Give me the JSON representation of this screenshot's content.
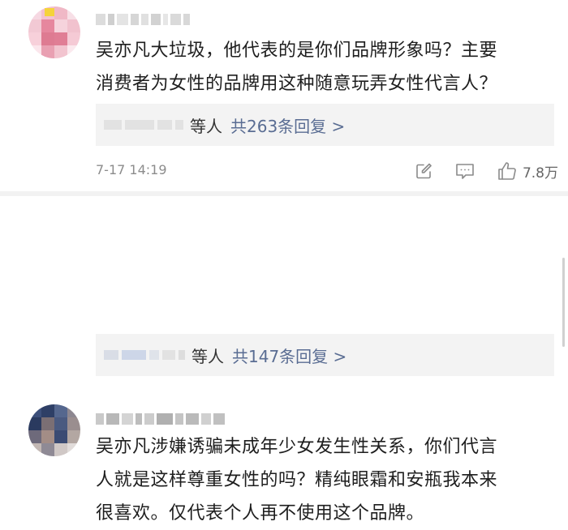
{
  "comments": [
    {
      "text_line1": "吴亦凡大垃圾，他代表的是你们品牌形象吗？主要",
      "text_line2": "消费者为女性的品牌用这种随意玩弄女性代言人？",
      "reply_label": "等人",
      "reply_link": "共263条回复 >",
      "time": "7-17 14:19",
      "like_count": "7.8万"
    },
    {
      "text_line1": "吴亦凡涉嫌诱骗未成年少女发生性关系，你们代言",
      "text_line2": "人就是这样尊重女性的吗？精纯眼霜和安瓶我本来",
      "text_line3": "很喜欢。仅代表个人再不使用这个品牌。",
      "reply_label": "等人",
      "reply_link": "共147条回复 >"
    }
  ],
  "icons": {
    "share": "share-icon",
    "comment": "comment-icon",
    "like": "thumbs-up-icon"
  },
  "colors": {
    "link": "#5a6d93",
    "meta_gray": "#8c8c8c",
    "reply_bg": "#f3f3f3"
  }
}
